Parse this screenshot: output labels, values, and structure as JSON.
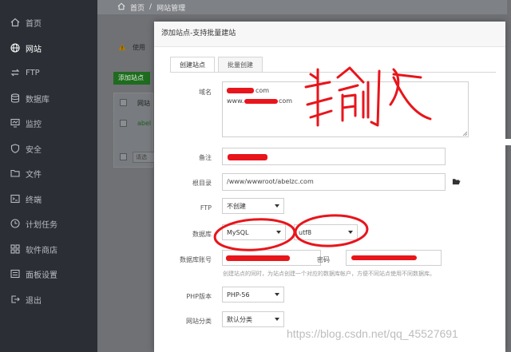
{
  "sidebar": {
    "items": [
      {
        "label": "首页",
        "icon": "home-icon"
      },
      {
        "label": "网站",
        "icon": "globe-icon",
        "active": true
      },
      {
        "label": "FTP",
        "icon": "ftp-icon"
      },
      {
        "label": "数据库",
        "icon": "database-icon"
      },
      {
        "label": "监控",
        "icon": "monitor-icon"
      },
      {
        "label": "安全",
        "icon": "shield-icon"
      },
      {
        "label": "文件",
        "icon": "folder-icon"
      },
      {
        "label": "终端",
        "icon": "terminal-icon"
      },
      {
        "label": "计划任务",
        "icon": "clock-icon"
      },
      {
        "label": "软件商店",
        "icon": "store-icon"
      },
      {
        "label": "面板设置",
        "icon": "settings-icon"
      },
      {
        "label": "退出",
        "icon": "logout-icon"
      }
    ]
  },
  "breadcrumb": {
    "home": "首页",
    "separator": "/",
    "current": "网站管理"
  },
  "background_page": {
    "warning_text": "使用",
    "add_button": "添加站点",
    "col_header": "网站",
    "row_site": "abel",
    "search_placeholder": "请选"
  },
  "modal": {
    "title": "添加站点-支持批量建站",
    "tabs": [
      "创建站点",
      "批量创建"
    ],
    "domain_label": "域名",
    "domain_lines": [
      "com",
      "www.",
      "com"
    ],
    "remark_label": "备注",
    "root_label": "根目录",
    "root_value": "/www/wwwroot/abelzc.com",
    "ftp_label": "FTP",
    "ftp_value": "不创建",
    "db_label": "数据库",
    "db_type": "MySQL",
    "db_charset": "utf8",
    "db_account_label": "数据库账号",
    "db_password_label": "密码",
    "db_hint": "创建站点的同时，为站点创建一个对应的数据库帐户，方便不同站点使用不同数据库。",
    "php_label": "PHP版本",
    "php_value": "PHP-56",
    "category_label": "网站分类",
    "category_value": "默认分类"
  },
  "annotation": {
    "handwritten_text": "输入",
    "color": "#e8151b"
  },
  "watermark": "https://blog.csdn.net/qq_45527691",
  "colors": {
    "sidebar_bg": "#2b2f35",
    "accent_red": "#e8151b",
    "add_button_green": "#1f6b1f"
  }
}
